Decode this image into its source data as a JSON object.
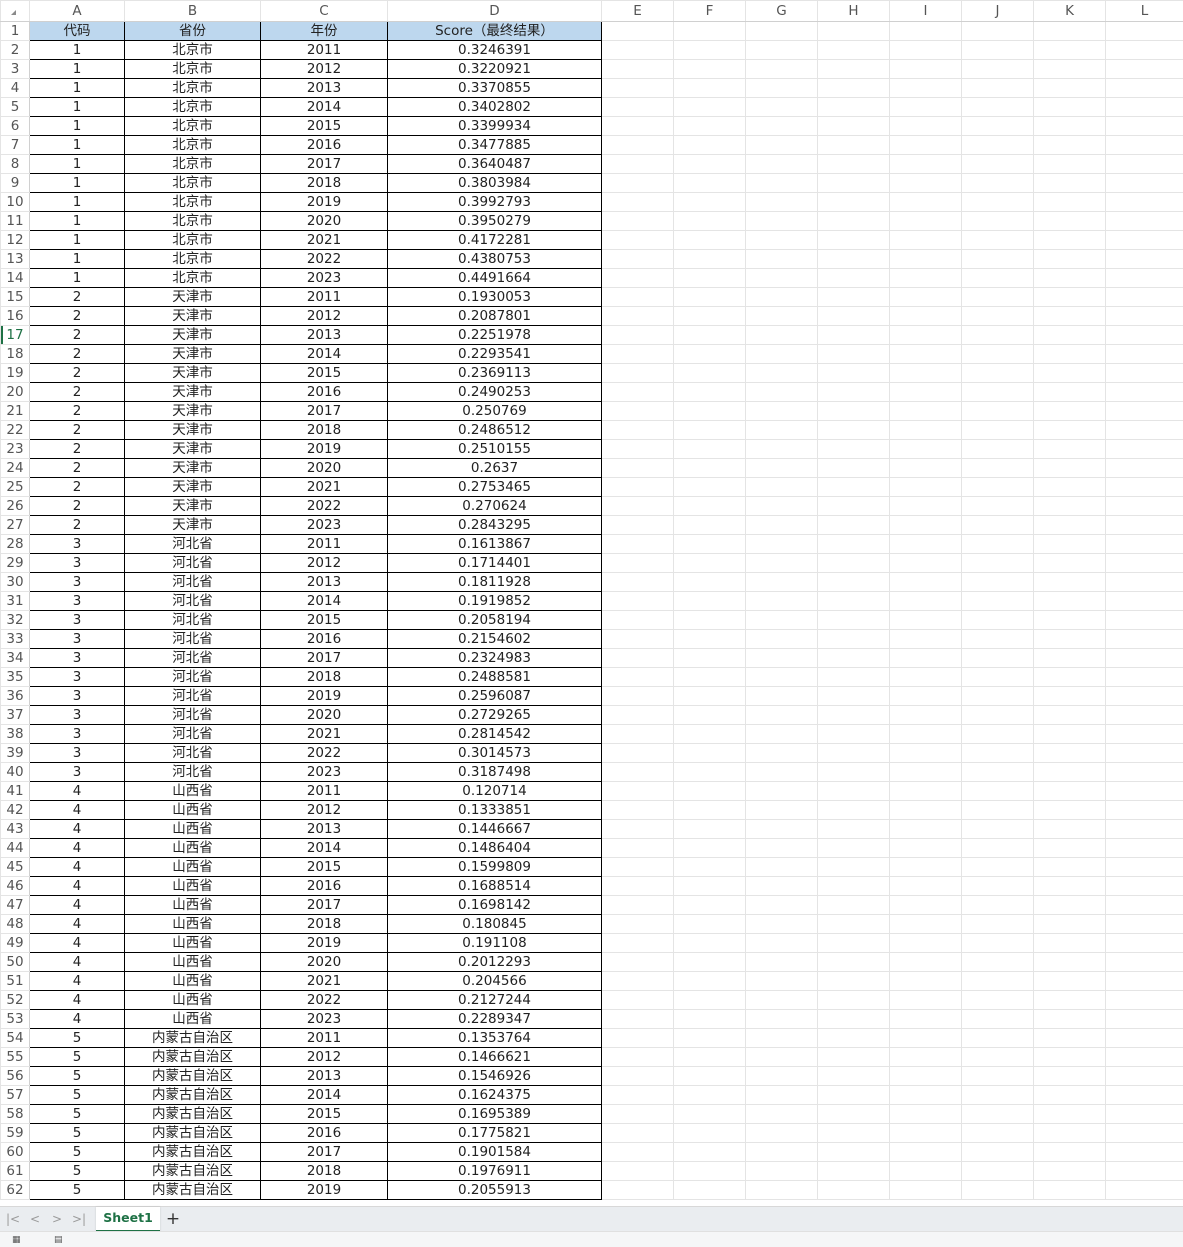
{
  "columns": [
    "A",
    "B",
    "C",
    "D",
    "E",
    "F",
    "G",
    "H",
    "I",
    "J",
    "K",
    "L"
  ],
  "headers": [
    "代码",
    "省份",
    "年份",
    "Score（最终结果）"
  ],
  "rows": [
    [
      1,
      "北京市",
      2011,
      "0.3246391"
    ],
    [
      1,
      "北京市",
      2012,
      "0.3220921"
    ],
    [
      1,
      "北京市",
      2013,
      "0.3370855"
    ],
    [
      1,
      "北京市",
      2014,
      "0.3402802"
    ],
    [
      1,
      "北京市",
      2015,
      "0.3399934"
    ],
    [
      1,
      "北京市",
      2016,
      "0.3477885"
    ],
    [
      1,
      "北京市",
      2017,
      "0.3640487"
    ],
    [
      1,
      "北京市",
      2018,
      "0.3803984"
    ],
    [
      1,
      "北京市",
      2019,
      "0.3992793"
    ],
    [
      1,
      "北京市",
      2020,
      "0.3950279"
    ],
    [
      1,
      "北京市",
      2021,
      "0.4172281"
    ],
    [
      1,
      "北京市",
      2022,
      "0.4380753"
    ],
    [
      1,
      "北京市",
      2023,
      "0.4491664"
    ],
    [
      2,
      "天津市",
      2011,
      "0.1930053"
    ],
    [
      2,
      "天津市",
      2012,
      "0.2087801"
    ],
    [
      2,
      "天津市",
      2013,
      "0.2251978"
    ],
    [
      2,
      "天津市",
      2014,
      "0.2293541"
    ],
    [
      2,
      "天津市",
      2015,
      "0.2369113"
    ],
    [
      2,
      "天津市",
      2016,
      "0.2490253"
    ],
    [
      2,
      "天津市",
      2017,
      "0.250769"
    ],
    [
      2,
      "天津市",
      2018,
      "0.2486512"
    ],
    [
      2,
      "天津市",
      2019,
      "0.2510155"
    ],
    [
      2,
      "天津市",
      2020,
      "0.2637"
    ],
    [
      2,
      "天津市",
      2021,
      "0.2753465"
    ],
    [
      2,
      "天津市",
      2022,
      "0.270624"
    ],
    [
      2,
      "天津市",
      2023,
      "0.2843295"
    ],
    [
      3,
      "河北省",
      2011,
      "0.1613867"
    ],
    [
      3,
      "河北省",
      2012,
      "0.1714401"
    ],
    [
      3,
      "河北省",
      2013,
      "0.1811928"
    ],
    [
      3,
      "河北省",
      2014,
      "0.1919852"
    ],
    [
      3,
      "河北省",
      2015,
      "0.2058194"
    ],
    [
      3,
      "河北省",
      2016,
      "0.2154602"
    ],
    [
      3,
      "河北省",
      2017,
      "0.2324983"
    ],
    [
      3,
      "河北省",
      2018,
      "0.2488581"
    ],
    [
      3,
      "河北省",
      2019,
      "0.2596087"
    ],
    [
      3,
      "河北省",
      2020,
      "0.2729265"
    ],
    [
      3,
      "河北省",
      2021,
      "0.2814542"
    ],
    [
      3,
      "河北省",
      2022,
      "0.3014573"
    ],
    [
      3,
      "河北省",
      2023,
      "0.3187498"
    ],
    [
      4,
      "山西省",
      2011,
      "0.120714"
    ],
    [
      4,
      "山西省",
      2012,
      "0.1333851"
    ],
    [
      4,
      "山西省",
      2013,
      "0.1446667"
    ],
    [
      4,
      "山西省",
      2014,
      "0.1486404"
    ],
    [
      4,
      "山西省",
      2015,
      "0.1599809"
    ],
    [
      4,
      "山西省",
      2016,
      "0.1688514"
    ],
    [
      4,
      "山西省",
      2017,
      "0.1698142"
    ],
    [
      4,
      "山西省",
      2018,
      "0.180845"
    ],
    [
      4,
      "山西省",
      2019,
      "0.191108"
    ],
    [
      4,
      "山西省",
      2020,
      "0.2012293"
    ],
    [
      4,
      "山西省",
      2021,
      "0.204566"
    ],
    [
      4,
      "山西省",
      2022,
      "0.2127244"
    ],
    [
      4,
      "山西省",
      2023,
      "0.2289347"
    ],
    [
      5,
      "内蒙古自治区",
      2011,
      "0.1353764"
    ],
    [
      5,
      "内蒙古自治区",
      2012,
      "0.1466621"
    ],
    [
      5,
      "内蒙古自治区",
      2013,
      "0.1546926"
    ],
    [
      5,
      "内蒙古自治区",
      2014,
      "0.1624375"
    ],
    [
      5,
      "内蒙古自治区",
      2015,
      "0.1695389"
    ],
    [
      5,
      "内蒙古自治区",
      2016,
      "0.1775821"
    ],
    [
      5,
      "内蒙古自治区",
      2017,
      "0.1901584"
    ],
    [
      5,
      "内蒙古自治区",
      2018,
      "0.1976911"
    ],
    [
      5,
      "内蒙古自治区",
      2019,
      "0.2055913"
    ]
  ],
  "active_row": 17,
  "sheet_tab": "Sheet1",
  "add_sheet_label": "+",
  "nav": {
    "first": "|<",
    "prev": "<",
    "next": ">",
    "last": ">|"
  },
  "colors": {
    "header_fill": "#bdd7ee",
    "accent": "#1e7145"
  }
}
